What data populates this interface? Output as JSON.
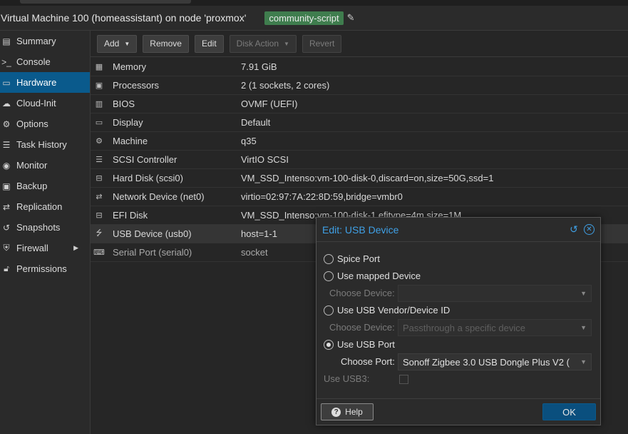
{
  "header": {
    "title": "Virtual Machine 100 (homeassistant) on node 'proxmox'",
    "tag": "community-script"
  },
  "sidebar": {
    "items": [
      {
        "label": "Summary",
        "icon": "book-icon"
      },
      {
        "label": "Console",
        "icon": "terminal-icon"
      },
      {
        "label": "Hardware",
        "icon": "desktop-icon",
        "active": true
      },
      {
        "label": "Cloud-Init",
        "icon": "cloud-icon"
      },
      {
        "label": "Options",
        "icon": "gear-icon"
      },
      {
        "label": "Task History",
        "icon": "list-icon"
      },
      {
        "label": "Monitor",
        "icon": "eye-icon"
      },
      {
        "label": "Backup",
        "icon": "floppy-icon"
      },
      {
        "label": "Replication",
        "icon": "retweet-icon"
      },
      {
        "label": "Snapshots",
        "icon": "history-icon"
      },
      {
        "label": "Firewall",
        "icon": "shield-icon",
        "has_submenu": true
      },
      {
        "label": "Permissions",
        "icon": "unlock-icon"
      }
    ]
  },
  "toolbar": {
    "add_label": "Add",
    "remove_label": "Remove",
    "edit_label": "Edit",
    "disk_action_label": "Disk Action",
    "revert_label": "Revert"
  },
  "hardware": {
    "rows": [
      {
        "name": "Memory",
        "value": "7.91 GiB",
        "icon": "memory-icon"
      },
      {
        "name": "Processors",
        "value": "2 (1 sockets, 2 cores)",
        "icon": "cpu-icon"
      },
      {
        "name": "BIOS",
        "value": "OVMF (UEFI)",
        "icon": "microchip-icon"
      },
      {
        "name": "Display",
        "value": "Default",
        "icon": "monitor-icon"
      },
      {
        "name": "Machine",
        "value": "q35",
        "icon": "cogs-icon"
      },
      {
        "name": "SCSI Controller",
        "value": "VirtIO SCSI",
        "icon": "database-icon"
      },
      {
        "name": "Hard Disk (scsi0)",
        "value": "VM_SSD_Intenso:vm-100-disk-0,discard=on,size=50G,ssd=1",
        "icon": "hdd-icon"
      },
      {
        "name": "Network Device (net0)",
        "value": "virtio=02:97:7A:22:8D:59,bridge=vmbr0",
        "icon": "exchange-icon"
      },
      {
        "name": "EFI Disk",
        "value": "VM_SSD_Intenso:vm-100-disk-1,efitype=4m,size=1M",
        "icon": "hdd-icon"
      },
      {
        "name": "USB Device (usb0)",
        "value": "host=1-1",
        "icon": "usb-icon",
        "selected": true
      },
      {
        "name": "Serial Port (serial0)",
        "value": "socket",
        "icon": "keyboard-icon",
        "dim": true
      }
    ]
  },
  "dialog": {
    "title": "Edit: USB Device",
    "options": {
      "spice": "Spice Port",
      "mapped": "Use mapped Device",
      "vendor": "Use USB Vendor/Device ID",
      "port": "Use USB Port"
    },
    "selected_option": "port",
    "choose_device_label": "Choose Device:",
    "mapped_device_value": "",
    "vendor_device_placeholder": "Passthrough a specific device",
    "choose_port_label": "Choose Port:",
    "port_value": "Sonoff Zigbee 3.0 USB Dongle Plus V2 (",
    "usb3_label": "Use USB3:",
    "usb3_checked": false,
    "help_label": "Help",
    "ok_label": "OK",
    "accent": "#3fa0e6"
  }
}
